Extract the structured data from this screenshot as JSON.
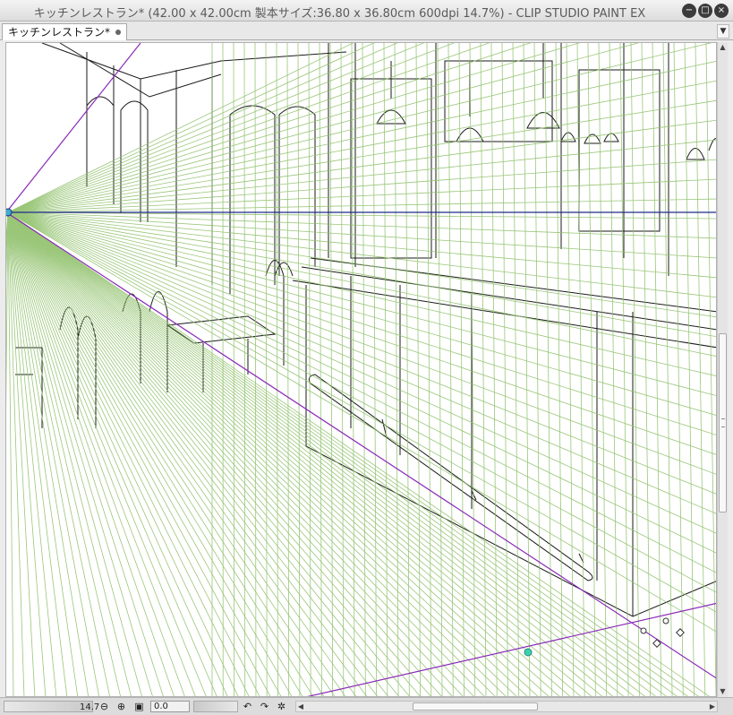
{
  "window": {
    "title": "キッチンレストラン* (42.00 x 42.00cm 製本サイズ:36.80 x 36.80cm 600dpi 14.7%)  - CLIP STUDIO PAINT EX",
    "buttons": {
      "minimize": "−",
      "maximize": "□",
      "close": "×"
    }
  },
  "tabs": [
    {
      "label": "キッチンレストラン*",
      "icon": "unsaved-dot-icon"
    }
  ],
  "tab_dropdown_icon": "chevron-down-icon",
  "canvas": {
    "description_icon": "perspective-ruler",
    "guide_color": "#7fb25a",
    "horizon_color": "#1f2a8a",
    "ruler_color": "#8a2ab8",
    "handle_color": "#3ad0b0"
  },
  "statusbar": {
    "zoom_value": "14.7",
    "rotation_value": "0.0",
    "icons": [
      "zoom-out-icon",
      "zoom-in-icon",
      "fit-canvas-icon",
      "rotate-left-icon",
      "rotate-right-icon",
      "reset-rotation-icon"
    ]
  }
}
